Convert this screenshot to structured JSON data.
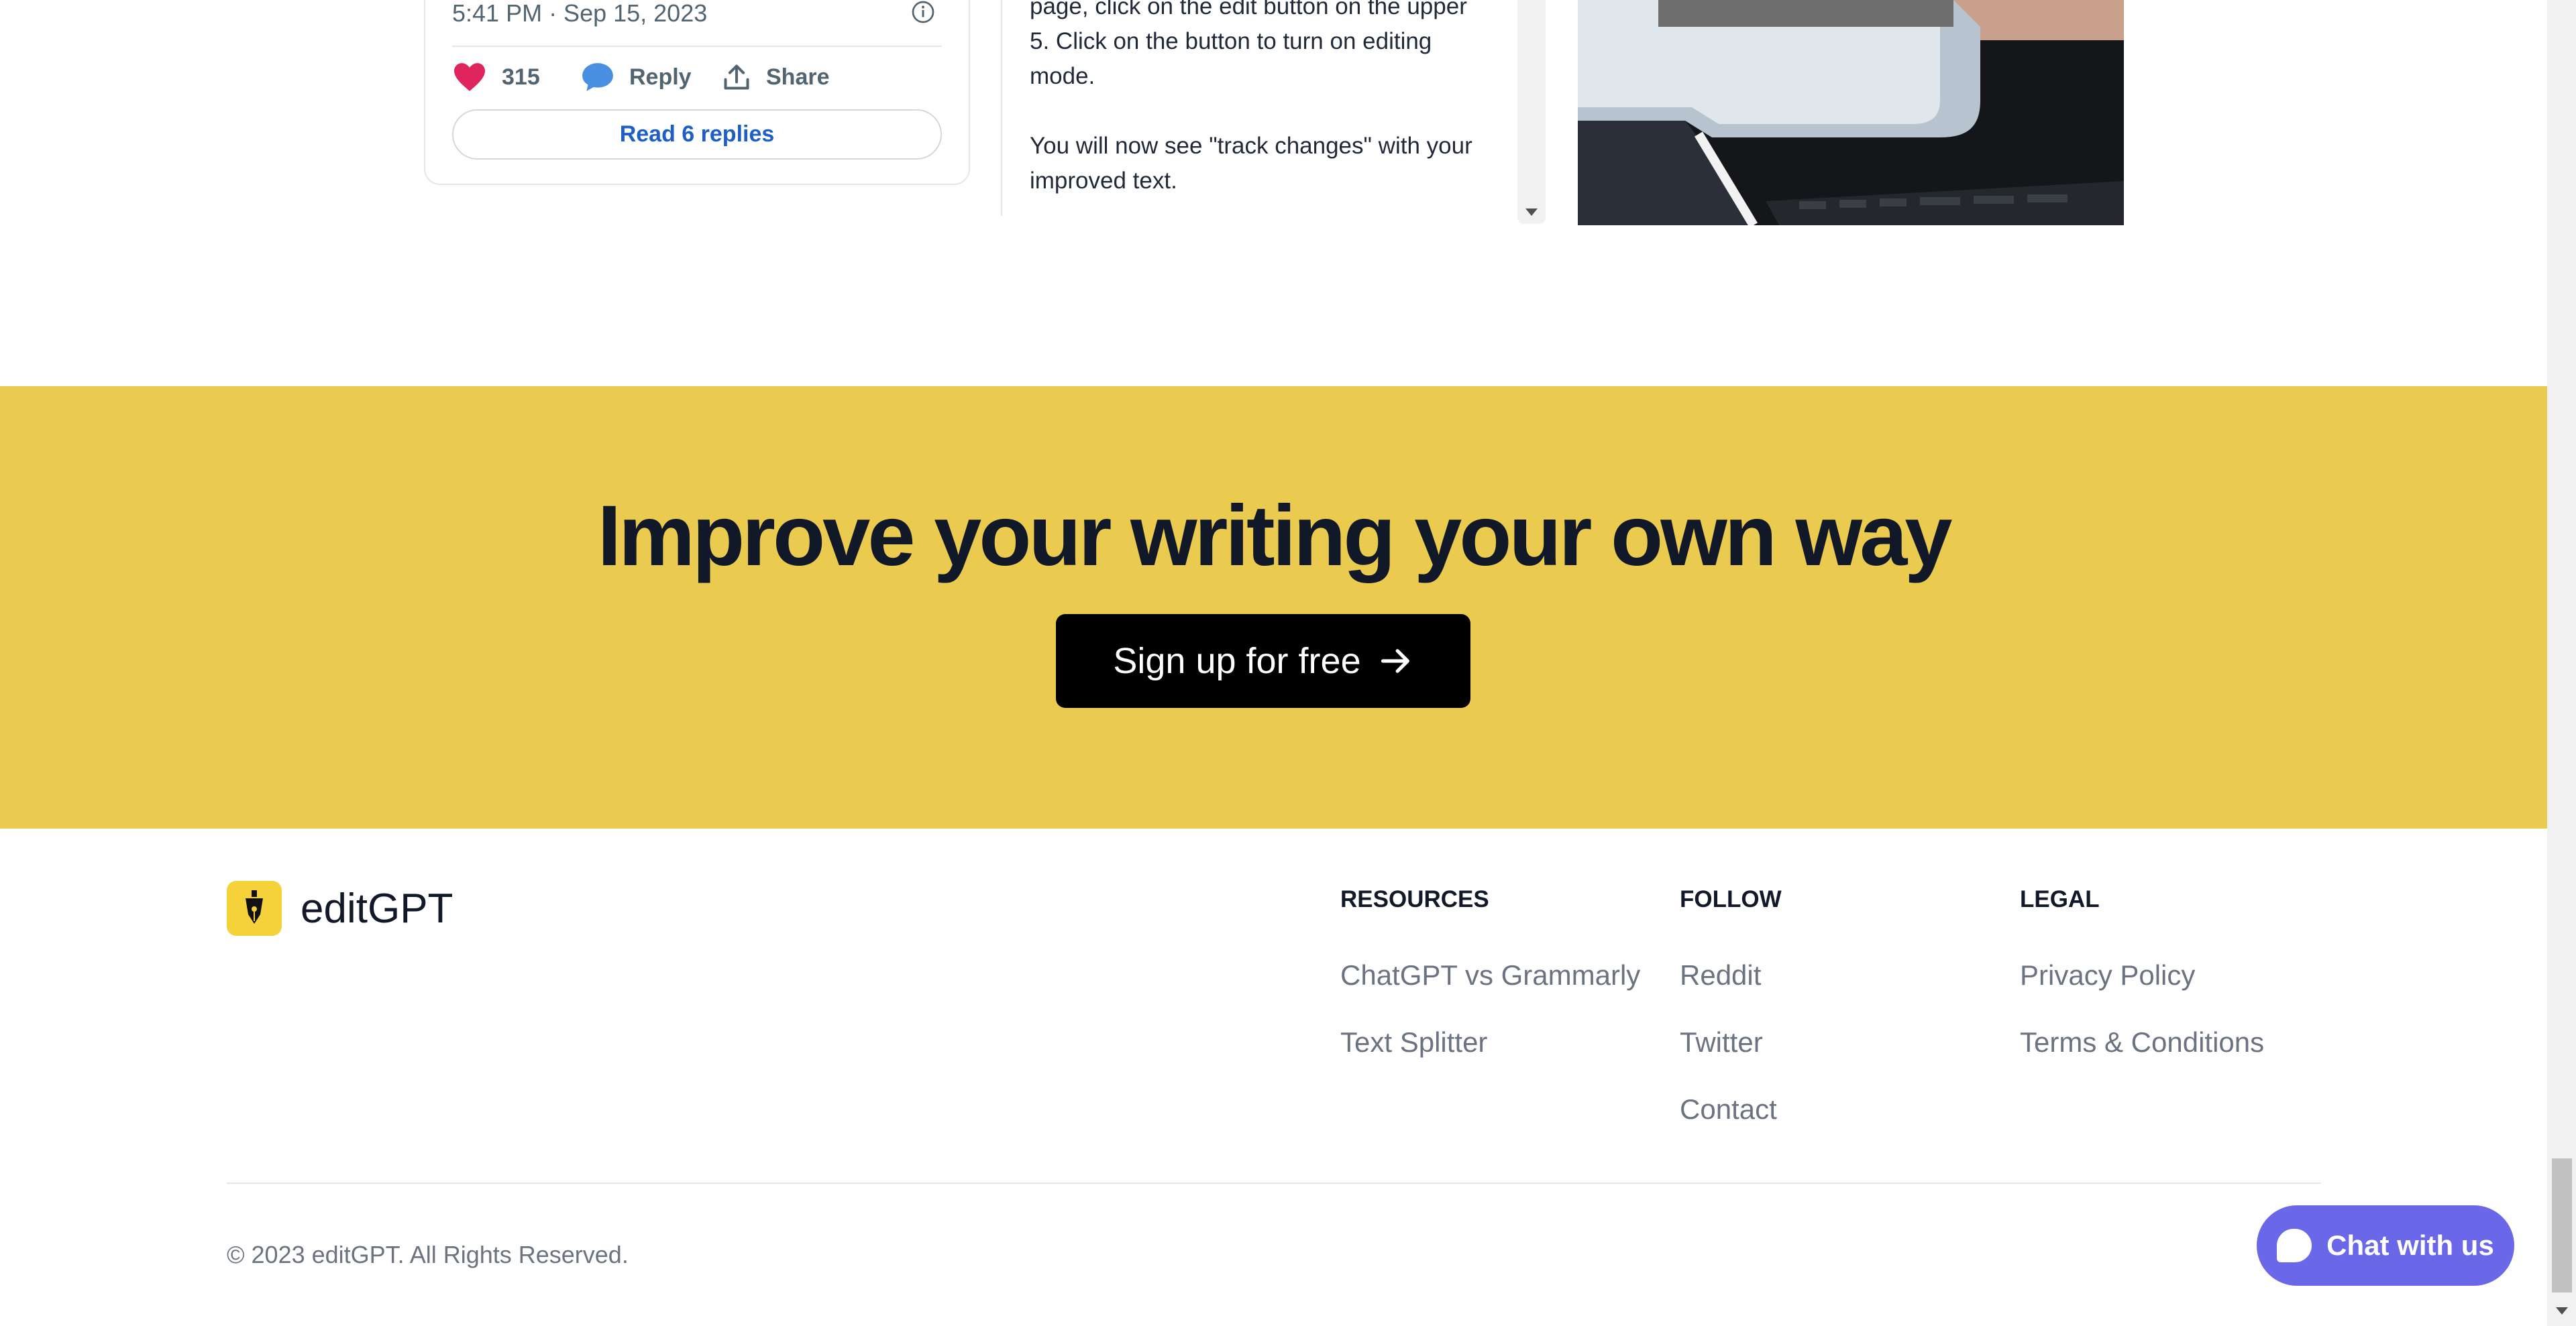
{
  "tweet": {
    "time": "5:41 PM · Sep 15, 2023",
    "likes": "315",
    "reply_label": "Reply",
    "share_label": "Share",
    "read_replies": "Read 6 replies"
  },
  "editor": {
    "line_1": "page, click on the edit button on the upper",
    "line_2": "5. Click on the button to turn on editing",
    "line_3": "mode.",
    "line_4": "You will now see \"track changes\" with your",
    "line_5": "improved text."
  },
  "cta": {
    "title": "Improve your writing your own way",
    "button_label": "Sign up for free"
  },
  "footer": {
    "brand": "editGPT",
    "columns": [
      {
        "heading": "RESOURCES",
        "links": [
          "ChatGPT vs Grammarly",
          "Text Splitter"
        ]
      },
      {
        "heading": "FOLLOW",
        "links": [
          "Reddit",
          "Twitter",
          "Contact"
        ]
      },
      {
        "heading": "LEGAL",
        "links": [
          "Privacy Policy",
          "Terms & Conditions"
        ]
      }
    ],
    "copyright": "© 2023 editGPT. All Rights Reserved."
  },
  "chat": {
    "label": "Chat with us"
  },
  "colors": {
    "cta_background": "#ebcb4f",
    "chat_button": "#6a67e9",
    "like_heart": "#e0245e",
    "reply_bubble": "#4a90e2",
    "link_blue": "#1d5fc7"
  }
}
